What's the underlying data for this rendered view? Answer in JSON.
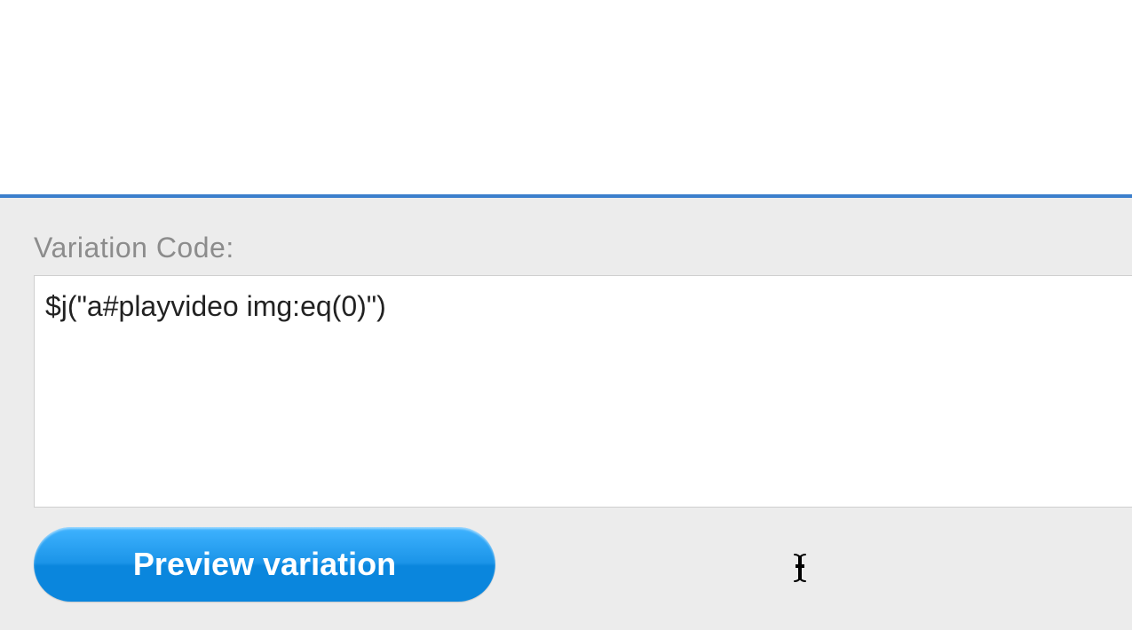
{
  "form": {
    "label": "Variation Code:",
    "code_value": "$j(\"a#playvideo img:eq(0)\")"
  },
  "buttons": {
    "preview_label": "Preview variation"
  }
}
